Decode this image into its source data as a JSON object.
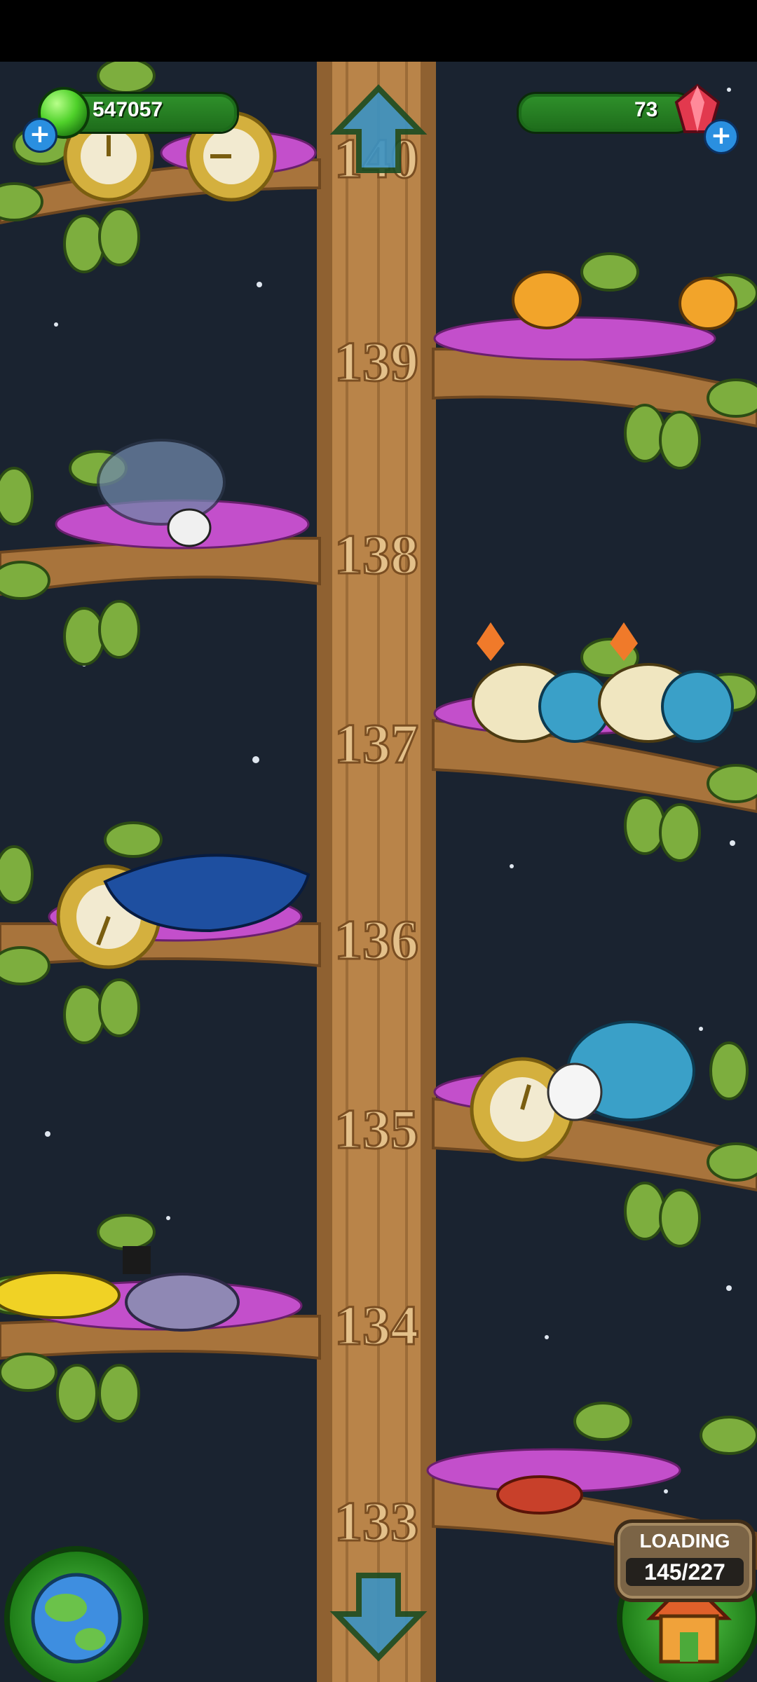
{
  "hud": {
    "coins_value": "547057",
    "gems_value": "73",
    "coins_plus_icon": "plus-icon",
    "gems_plus_icon": "plus-icon",
    "coins_icon": "green-gem-icon",
    "gems_icon": "red-crystal-icon"
  },
  "tree": {
    "levels": [
      "140",
      "139",
      "138",
      "137",
      "136",
      "135",
      "134",
      "133"
    ]
  },
  "loading": {
    "label": "LOADING",
    "progress": "145/227",
    "progress_fraction": 0.6388
  },
  "nav": {
    "up_icon": "arrow-up-icon",
    "down_icon": "arrow-down-icon",
    "globe_icon": "globe-icon",
    "home_icon": "house-icon"
  },
  "colors": {
    "sky": "#1a2330",
    "trunk": "#b98449",
    "leaf": "#7dae3e",
    "hud_green": "#2e8f2a",
    "nest_pink": "#c34fcb"
  }
}
